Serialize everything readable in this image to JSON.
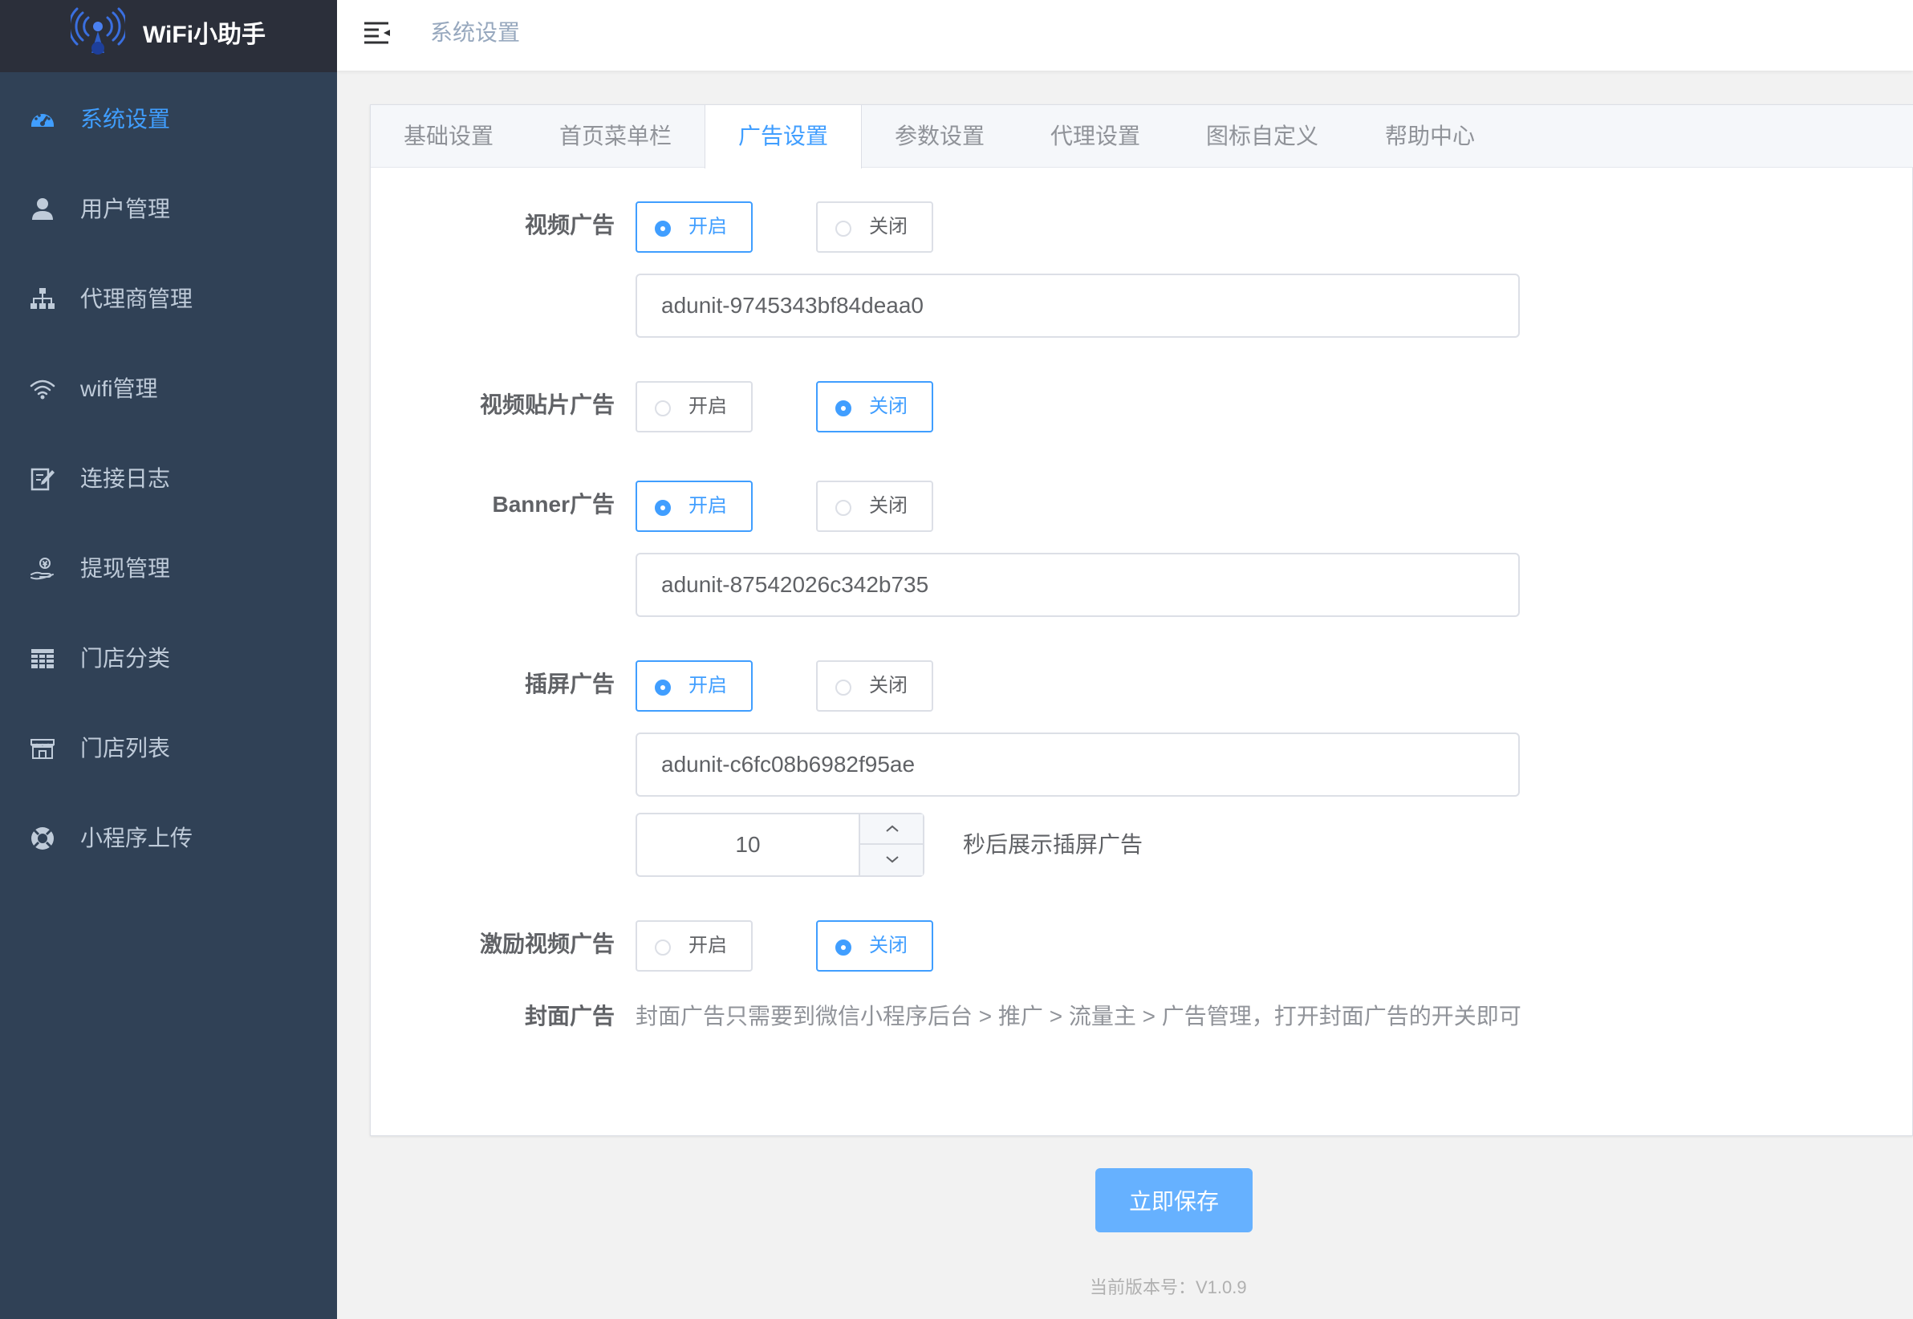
{
  "app": {
    "title": "WiFi小助手"
  },
  "header": {
    "breadcrumb": "系统设置"
  },
  "sidebar": {
    "items": [
      {
        "label": "系统设置",
        "icon": "dashboard-icon",
        "active": true
      },
      {
        "label": "用户管理",
        "icon": "user-icon"
      },
      {
        "label": "代理商管理",
        "icon": "sitemap-icon"
      },
      {
        "label": "wifi管理",
        "icon": "wifi-icon"
      },
      {
        "label": "连接日志",
        "icon": "edit-log-icon"
      },
      {
        "label": "提现管理",
        "icon": "withdraw-icon"
      },
      {
        "label": "门店分类",
        "icon": "grid-icon"
      },
      {
        "label": "门店列表",
        "icon": "store-icon"
      },
      {
        "label": "小程序上传",
        "icon": "lifebuoy-icon"
      }
    ]
  },
  "tabs": [
    "基础设置",
    "首页菜单栏",
    "广告设置",
    "参数设置",
    "代理设置",
    "图标自定义",
    "帮助中心"
  ],
  "active_tab": "广告设置",
  "form": {
    "video_ad": {
      "label": "视频广告",
      "on_label": "开启",
      "off_label": "关闭",
      "selected": "开启",
      "unit_id": "adunit-9745343bf84deaa0"
    },
    "video_patch_ad": {
      "label": "视频贴片广告",
      "on_label": "开启",
      "off_label": "关闭",
      "selected": "关闭"
    },
    "banner_ad": {
      "label": "Banner广告",
      "on_label": "开启",
      "off_label": "关闭",
      "selected": "开启",
      "unit_id": "adunit-87542026c342b735"
    },
    "interstitial_ad": {
      "label": "插屏广告",
      "on_label": "开启",
      "off_label": "关闭",
      "selected": "开启",
      "unit_id": "adunit-c6fc08b6982f95ae",
      "delay_seconds": "10",
      "delay_suffix": "秒后展示插屏广告"
    },
    "rewarded_video_ad": {
      "label": "激励视频广告",
      "on_label": "开启",
      "off_label": "关闭",
      "selected": "关闭"
    },
    "cover_ad": {
      "label": "封面广告",
      "note": "封面广告只需要到微信小程序后台 > 推广 > 流量主 > 广告管理，打开封面广告的开关即可"
    }
  },
  "footer": {
    "save_label": "立即保存",
    "version": "当前版本号：V1.0.9"
  },
  "colors": {
    "sidebar_bg": "#304156",
    "logo_bar_bg": "#2b2f3a",
    "accent": "#409eff",
    "save_button": "#66b1ff"
  }
}
